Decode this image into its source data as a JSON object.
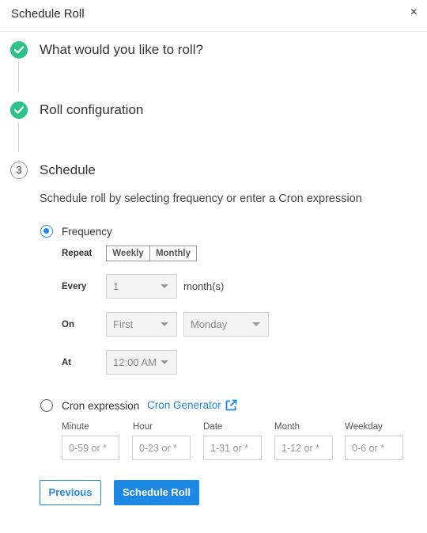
{
  "dialog": {
    "title": "Schedule Roll",
    "close_glyph": "×"
  },
  "steps": [
    {
      "label": "What would you like to roll?",
      "state": "complete",
      "icon": "check-icon"
    },
    {
      "label": "Roll configuration",
      "state": "complete",
      "icon": "check-icon"
    },
    {
      "number": "3",
      "label": "Schedule",
      "state": "active"
    }
  ],
  "schedule": {
    "description": "Schedule roll by selecting frequency or enter a Cron expression",
    "frequency": {
      "label": "Frequency",
      "selected": true,
      "repeat_label": "Repeat",
      "repeat_options": [
        "Weekly",
        "Monthly"
      ],
      "every_label": "Every",
      "every_value": "1",
      "every_unit": "month(s)",
      "on_label": "On",
      "on_ordinal": "First",
      "on_day": "Monday",
      "at_label": "At",
      "at_time": "12:00 AM"
    },
    "cron": {
      "label": "Cron expression",
      "selected": false,
      "generator_link": "Cron Generator",
      "generator_icon": "external-link-icon",
      "fields": [
        {
          "label": "Minute",
          "placeholder": "0-59 or *"
        },
        {
          "label": "Hour",
          "placeholder": "0-23 or *"
        },
        {
          "label": "Date",
          "placeholder": "1-31 or *"
        },
        {
          "label": "Month",
          "placeholder": "1-12 or *"
        },
        {
          "label": "Weekday",
          "placeholder": "0-6 or *"
        }
      ]
    }
  },
  "actions": {
    "previous": "Previous",
    "submit": "Schedule Roll"
  },
  "colors": {
    "accent": "#1e88e5",
    "success": "#2cc28a",
    "divider": "#e3e3e3"
  }
}
